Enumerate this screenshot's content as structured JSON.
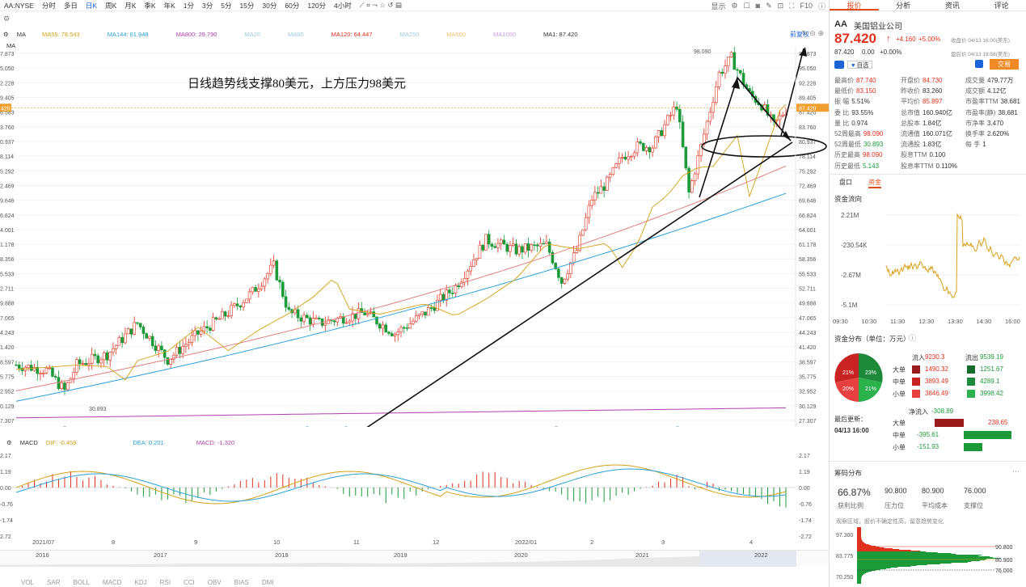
{
  "toolbar": {
    "symbol": "AA:NYSE",
    "periods": [
      "分时",
      "多日",
      "日K",
      "周K",
      "月K",
      "季K",
      "年K",
      "1分",
      "3分",
      "5分",
      "15分",
      "30分",
      "60分",
      "120分",
      "4小时"
    ],
    "active_period": "日K",
    "right": [
      "显示",
      "F10"
    ]
  },
  "ma_row1": [
    {
      "label": "MA",
      "color": "#333"
    },
    {
      "label": "MA55: 78.543",
      "color": "#d4a017"
    },
    {
      "label": "MA144: 61.948",
      "color": "#2aa0d8"
    },
    {
      "label": "MA800: 29.790",
      "color": "#b040b0"
    },
    {
      "label": "MA20",
      "color": "#9ecae1"
    },
    {
      "label": "MA60",
      "color": "#9ecae1"
    },
    {
      "label": "MA120: 64.447",
      "color": "#e0301e"
    },
    {
      "label": "MA250",
      "color": "#9ecae1"
    },
    {
      "label": "MA500",
      "color": "#f0c070"
    },
    {
      "label": "MA1000",
      "color": "#c8a0e0"
    },
    {
      "label": "MA1: 87.420",
      "color": "#333"
    }
  ],
  "ma_row2": "MA",
  "pre_restore": "前复权",
  "annotation_text": "日线趋势线支撑80美元，上方压力98美元",
  "price_axis": [
    "7.873",
    "5.050",
    "2.228",
    "9.405",
    "6.583",
    "3.760",
    "0.937",
    "8.114",
    "5.292",
    "2.469",
    "9.646",
    "6.824",
    "4.001",
    "1.178",
    "8.356",
    "5.533",
    "2.711",
    "9.888",
    "7.065",
    "4.243",
    "1.420",
    "8.597",
    "5.775",
    "2.952",
    "0.129",
    "7.307"
  ],
  "price_axis_right": [
    "87.873",
    "95.050",
    "92.228",
    "89.405",
    "87.420",
    "83.760",
    "80.937",
    "78.114",
    "75.292",
    "72.469",
    "69.646",
    "66.824",
    "64.001",
    "61.178",
    "58.356",
    "55.533",
    "52.711",
    "49.888",
    "47.065",
    "44.243",
    "41.420",
    "38.597",
    "35.775",
    "32.952",
    "30.129",
    "27.307"
  ],
  "price_left_tag": "420",
  "high_label": "98.090",
  "low_label": "30.893",
  "macd": {
    "title": "MACD",
    "dif": "DIF: -0.459",
    "dea": "DEA: 0.201",
    "macd": "MACD: -1.320",
    "axis_left": [
      "2.17",
      "1.19",
      "0.00",
      "-0.76",
      "-1.74",
      "2.72"
    ],
    "axis_right": [
      "2.17",
      "1.19",
      "0.00",
      "-0.76",
      "-1.74",
      "-2.72"
    ]
  },
  "time_labels": [
    "2021/07",
    "8",
    "9",
    "10",
    "11",
    "12",
    "2022/01",
    "2",
    "3",
    "4"
  ],
  "nav_labels": [
    "2016",
    "2017",
    "2018",
    "2019",
    "2020",
    "2021",
    "2022"
  ],
  "bottom_tabs": [
    "VOL",
    "SAR",
    "BOLL",
    "MACD",
    "KDJ",
    "RSI",
    "CCI",
    "OBV",
    "BIAS",
    "DMI"
  ],
  "panel": {
    "tabs": [
      "报价",
      "分析",
      "资讯",
      "评论"
    ],
    "code": "AA",
    "name": "美国铝业公司",
    "price": "87.420",
    "arrow": "↑",
    "change": "+4.160",
    "change_pct": "+5.00%",
    "close_time": "收盘价 04/13 16:00(美东)",
    "after_price": "87.420",
    "after_change": "0.00",
    "after_pct": "+0.00%",
    "after_time": "盘后价 04/13 19:58(美东)",
    "self_select": "自选",
    "trade": "交易",
    "grid": [
      [
        "最高价",
        "87.740",
        "red"
      ],
      [
        "开盘价",
        "84.730",
        "red"
      ],
      [
        "成交量",
        "479.77万",
        ""
      ],
      [
        "最低价",
        "83.150",
        "red"
      ],
      [
        "昨收价",
        "83.260",
        ""
      ],
      [
        "成交额",
        "4.12亿",
        ""
      ],
      [
        "振    幅",
        "5.51%",
        ""
      ],
      [
        "平均价",
        "85.897",
        "red"
      ],
      [
        "市盈率TTM",
        "38.681",
        ""
      ],
      [
        "委    比",
        "93.55%",
        ""
      ],
      [
        "总市值",
        "160.940亿",
        ""
      ],
      [
        "市盈率(静)",
        "38.681",
        ""
      ],
      [
        "量    比",
        "0.974",
        ""
      ],
      [
        "总股本",
        "1.84亿",
        ""
      ],
      [
        "市净率",
        "3.470",
        ""
      ],
      [
        "52周最高",
        "98.090",
        "red"
      ],
      [
        "流通值",
        "160.071亿",
        ""
      ],
      [
        "换手率",
        "2.620%",
        ""
      ],
      [
        "52周最低",
        "30.893",
        "green"
      ],
      [
        "流通股",
        "1.83亿",
        ""
      ],
      [
        "每    手",
        "1",
        ""
      ],
      [
        "历史最高",
        "98.090",
        "red"
      ],
      [
        "股息TTM",
        "0.100",
        ""
      ],
      [
        "",
        ""
      ],
      [
        "历史最低",
        "5.143",
        "green"
      ],
      [
        "股息率TTM",
        "0.110%",
        ""
      ],
      [
        "",
        ""
      ]
    ],
    "sub_tabs": [
      "盘口",
      "资金"
    ],
    "flow_title": "资金流向",
    "flow_axis": [
      "2.21M",
      "-230.54K",
      "-2.67M",
      "-5.1M"
    ],
    "flow_times": [
      "09:30",
      "10:30",
      "11:30",
      "12:30",
      "13:30",
      "14:30",
      "16:00"
    ],
    "dist_title": "资金分布（单位：万元）",
    "inflow_label": "流入",
    "inflow": "9230.3",
    "outflow_label": "流出",
    "outflow": "9539.19",
    "dist_rows": [
      {
        "name": "大单",
        "in": "1490.32",
        "out": "1251.67"
      },
      {
        "name": "中单",
        "in": "3893.49",
        "out": "4289.1"
      },
      {
        "name": "小单",
        "in": "3846.49",
        "out": "3998.42"
      }
    ],
    "pie_labels": [
      "21%",
      "23%",
      "20%",
      "21%"
    ],
    "latest_update": "最后更新：",
    "latest_time": "04/13 16:00",
    "net_label": "净流入",
    "net_value": "-308.89",
    "net_rows": [
      {
        "name": "大单",
        "value": "238.65"
      },
      {
        "name": "中单",
        "value": "-395.61"
      },
      {
        "name": "小单",
        "value": "-151.93"
      }
    ],
    "chip_title": "筹码分布",
    "chip_stats": [
      {
        "value": "66.87%",
        "label": "获利比例"
      },
      {
        "value": "90.800",
        "label": "压力位"
      },
      {
        "value": "80.900",
        "label": "平均成本"
      },
      {
        "value": "76.000",
        "label": "支撑位"
      }
    ],
    "chip_note": "观察区域，股价不确定性高，留意趋势变化",
    "chip_axis": [
      "97.300",
      "83.775",
      "70.250"
    ],
    "chip_marks": [
      "90.800",
      "80.900",
      "76.000"
    ]
  },
  "chart_data": {
    "type": "candlestick",
    "symbol": "AA:NYSE",
    "last": 87.42,
    "ylim": [
      27.307,
      97.873
    ],
    "high": 98.09,
    "low": 30.893,
    "ma_values": {
      "MA55": 78.543,
      "MA144": 61.948,
      "MA800": 29.79,
      "MA120": 64.447,
      "MA1": 87.42
    }
  }
}
